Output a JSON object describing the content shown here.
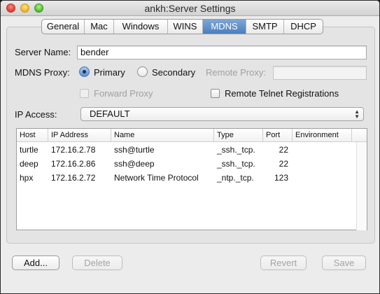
{
  "window": {
    "title": "ankh:Server Settings"
  },
  "tabs": [
    {
      "label": "General"
    },
    {
      "label": "Mac"
    },
    {
      "label": "Windows"
    },
    {
      "label": "WINS"
    },
    {
      "label": "MDNS"
    },
    {
      "label": "SMTP"
    },
    {
      "label": "DHCP"
    }
  ],
  "active_tab": "MDNS",
  "form": {
    "server_name_label": "Server Name:",
    "server_name_value": "bender",
    "mdns_proxy_label": "MDNS Proxy:",
    "primary_label": "Primary",
    "primary_checked": true,
    "secondary_label": "Secondary",
    "secondary_checked": false,
    "remote_proxy_label": "Remote Proxy:",
    "remote_proxy_value": "",
    "forward_proxy_label": "Forward Proxy",
    "forward_proxy_checked": false,
    "remote_telnet_label": "Remote Telnet Registrations",
    "remote_telnet_checked": false,
    "ip_access_label": "IP Access:",
    "ip_access_value": "DEFAULT"
  },
  "table": {
    "columns": [
      "Host",
      "IP Address",
      "Name",
      "Type",
      "Port",
      "Environment"
    ],
    "rows": [
      {
        "host": "turtle",
        "ip": "172.16.2.78",
        "name": "ssh@turtle",
        "type": "_ssh._tcp.",
        "port": "22",
        "env": ""
      },
      {
        "host": "deep",
        "ip": "172.16.2.86",
        "name": "ssh@deep",
        "type": "_ssh._tcp.",
        "port": "22",
        "env": ""
      },
      {
        "host": "hpx",
        "ip": "172.16.2.72",
        "name": "Network Time Protocol",
        "type": "_ntp._tcp.",
        "port": "123",
        "env": ""
      }
    ]
  },
  "buttons": {
    "add": "Add...",
    "delete": "Delete",
    "revert": "Revert",
    "save": "Save"
  },
  "colors": {
    "active_tab": "#4a7ec0",
    "window_bg": "#ececec"
  }
}
